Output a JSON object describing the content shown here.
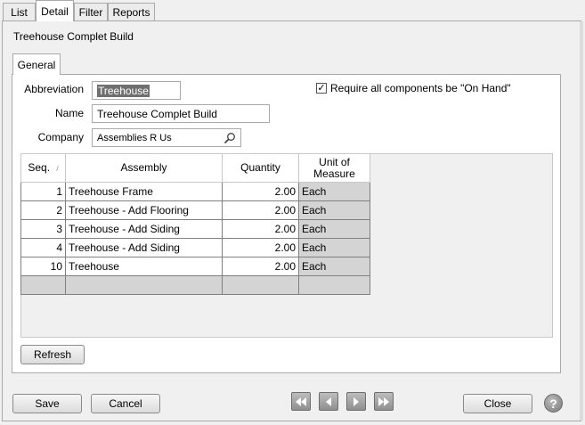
{
  "tabs": [
    "List",
    "Detail",
    "Filter",
    "Reports"
  ],
  "active_tab": "Detail",
  "record_title": "Treehouse Complet Build",
  "inner_tab": "General",
  "form": {
    "abbreviation_label": "Abbreviation",
    "abbreviation_value": "Treehouse",
    "name_label": "Name",
    "name_value": "Treehouse Complet Build",
    "company_label": "Company",
    "company_value": "Assemblies R Us",
    "require_label": "Require all components be \"On Hand\"",
    "require_checked": true
  },
  "grid": {
    "columns": [
      "Seq.",
      "Assembly",
      "Quantity",
      "Unit of Measure"
    ],
    "rows": [
      {
        "seq": "1",
        "assembly": "Treehouse Frame",
        "quantity": "2.00",
        "unit": "Each"
      },
      {
        "seq": "2",
        "assembly": "Treehouse - Add Flooring",
        "quantity": "2.00",
        "unit": "Each"
      },
      {
        "seq": "3",
        "assembly": "Treehouse - Add Siding",
        "quantity": "2.00",
        "unit": "Each"
      },
      {
        "seq": "4",
        "assembly": "Treehouse - Add Siding",
        "quantity": "2.00",
        "unit": "Each"
      },
      {
        "seq": "10",
        "assembly": "Treehouse",
        "quantity": "2.00",
        "unit": "Each"
      }
    ]
  },
  "buttons": {
    "refresh": "Refresh",
    "save": "Save",
    "cancel": "Cancel",
    "close": "Close",
    "help": "?"
  },
  "icons": {
    "search": "magnifier-icon",
    "nav": [
      "first-record-icon",
      "previous-record-icon",
      "next-record-icon",
      "last-record-icon"
    ]
  }
}
